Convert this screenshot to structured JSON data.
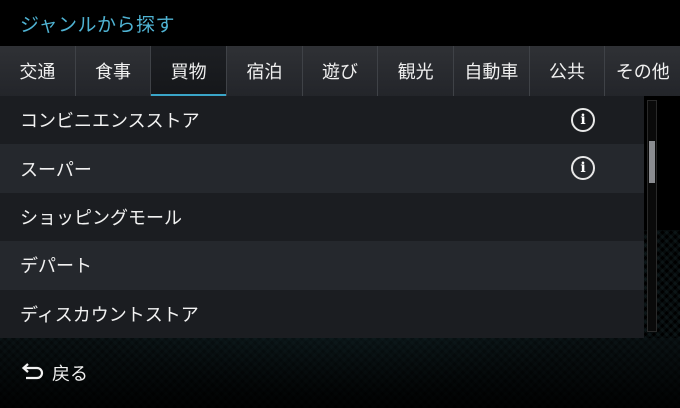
{
  "header": {
    "title": "ジャンルから探す"
  },
  "tabs": [
    {
      "label": "交通"
    },
    {
      "label": "食事"
    },
    {
      "label": "買物"
    },
    {
      "label": "宿泊"
    },
    {
      "label": "遊び"
    },
    {
      "label": "観光"
    },
    {
      "label": "自動車"
    },
    {
      "label": "公共"
    },
    {
      "label": "その他"
    }
  ],
  "active_tab": "買物",
  "list": {
    "items": [
      {
        "label": "コンビニエンスストア",
        "icon": "info-icon"
      },
      {
        "label": "スーパー",
        "icon": "info-icon"
      },
      {
        "label": "ショッピングモール"
      },
      {
        "label": "デパート"
      },
      {
        "label": "ディスカウントストア"
      }
    ],
    "info_glyph": "i"
  },
  "footer": {
    "back_label": "戻る",
    "back_icon": "return-arrow-icon"
  },
  "colors": {
    "accent": "#4fb3d3",
    "row_dark": "#1b1d21",
    "row_light": "#25282d"
  }
}
